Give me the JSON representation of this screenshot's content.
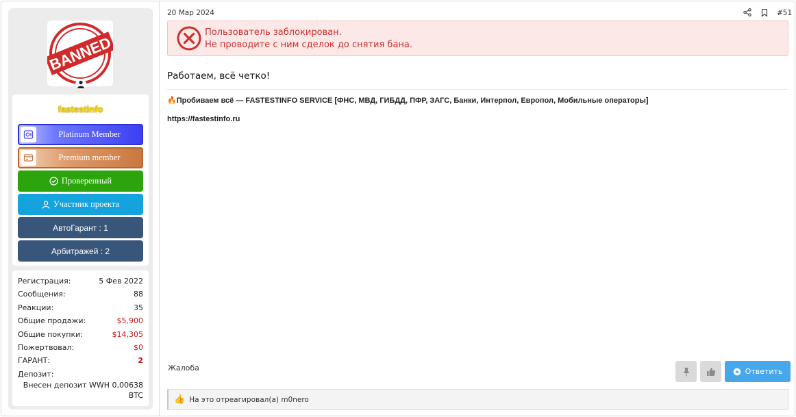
{
  "user": {
    "avatar_stamp_text": "BANNED",
    "username": "fastestinfo",
    "badges": {
      "platinum": "Platinum Member",
      "premium": "Premium member",
      "verified": "Проверенный",
      "member": "Участник проекта",
      "autogarant": "АвтоГарант : 1",
      "arbitration": "Арбитражей : 2"
    },
    "stats": [
      {
        "key": "Регистрация:",
        "value": "5 Фев 2022"
      },
      {
        "key": "Сообщения:",
        "value": "88"
      },
      {
        "key": "Реакции:",
        "value": "35"
      },
      {
        "key": "Общие продажи:",
        "value": "$5,900"
      },
      {
        "key": "Общие покупки:",
        "value": "$14,305"
      },
      {
        "key": "Пожертвовал:",
        "value": "$0"
      },
      {
        "key": "ГАРАНТ:",
        "value": "2"
      }
    ],
    "deposit_label": "Депозит:",
    "deposit_value": "Внесен депозит WWH 0,00638 BTC"
  },
  "post": {
    "date": "20 Мар 2024",
    "number": "#51",
    "ban_notice": {
      "line1": "Пользователь заблокирован.",
      "line2": "Не проводите с ним сделок до снятия бана."
    },
    "message": "Работаем, всё четко!",
    "signature": {
      "emoji": "🔥",
      "text": "Пробиваем всё — FASTESTINFO SERVICE [ФНС, МВД, ГИБДД, ПФР, ЗАГС, Банки, Интерпол, Европол, Мобильные операторы]",
      "url": "https://fastestinfo.ru"
    },
    "actions": {
      "report": "Жалоба",
      "reply": "Ответить"
    },
    "reactions": {
      "emoji": "👍",
      "text": "На это отреагировал(а) m0nero"
    }
  },
  "colors": {
    "ban_text": "#c9302c",
    "ban_bg": "#fde8e8",
    "verified": "#2ca40d",
    "member": "#14a3dc",
    "navy": "#38567a",
    "reply": "#47a7eb",
    "money_red": "#c91414"
  }
}
